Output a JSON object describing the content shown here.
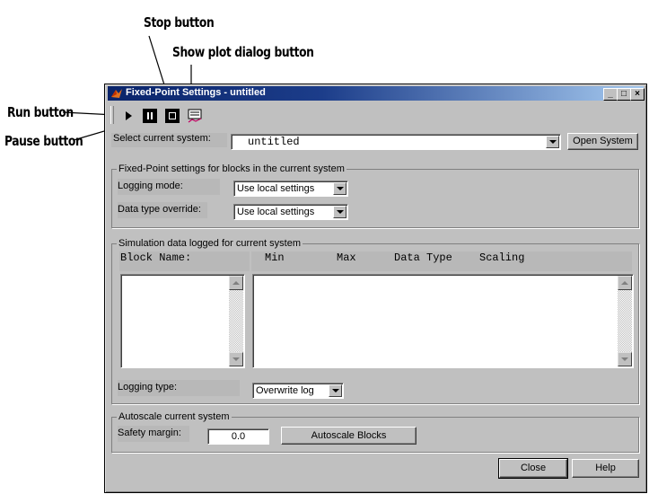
{
  "callouts": {
    "stop": "Stop button",
    "show_plot": "Show plot dialog button",
    "run": "Run button",
    "pause": "Pause button"
  },
  "window": {
    "title": "Fixed-Point Settings - untitled",
    "titlebar_buttons": {
      "minimize": "_",
      "maximize": "□",
      "close": "×"
    }
  },
  "toolbar": {
    "run_icon": "play-icon",
    "pause_icon": "pause-icon",
    "stop_icon": "stop-icon",
    "plot_icon": "plot-dialog-icon"
  },
  "system": {
    "label": "Select current system:",
    "value": "untitled",
    "open_button": "Open System"
  },
  "fixed_point": {
    "title": "Fixed-Point settings for blocks in the current system",
    "logging_mode_label": "Logging mode:",
    "logging_mode_value": "Use local settings",
    "override_label": "Data type override:",
    "override_value": "Use local settings"
  },
  "simulation": {
    "title": "Simulation data logged for current system",
    "block_name_header": "Block Name:",
    "columns": [
      "Min",
      "Max",
      "Data Type",
      "Scaling"
    ],
    "logging_type_label": "Logging type:",
    "logging_type_value": "Overwrite log"
  },
  "autoscale": {
    "title": "Autoscale current system",
    "safety_label": "Safety margin:",
    "safety_value": "0.0",
    "button": "Autoscale Blocks"
  },
  "footer": {
    "close": "Close",
    "help": "Help"
  },
  "colors": {
    "titlebar_start": "#0a246a",
    "titlebar_end": "#a6caf0",
    "face": "#c0c0c0"
  }
}
